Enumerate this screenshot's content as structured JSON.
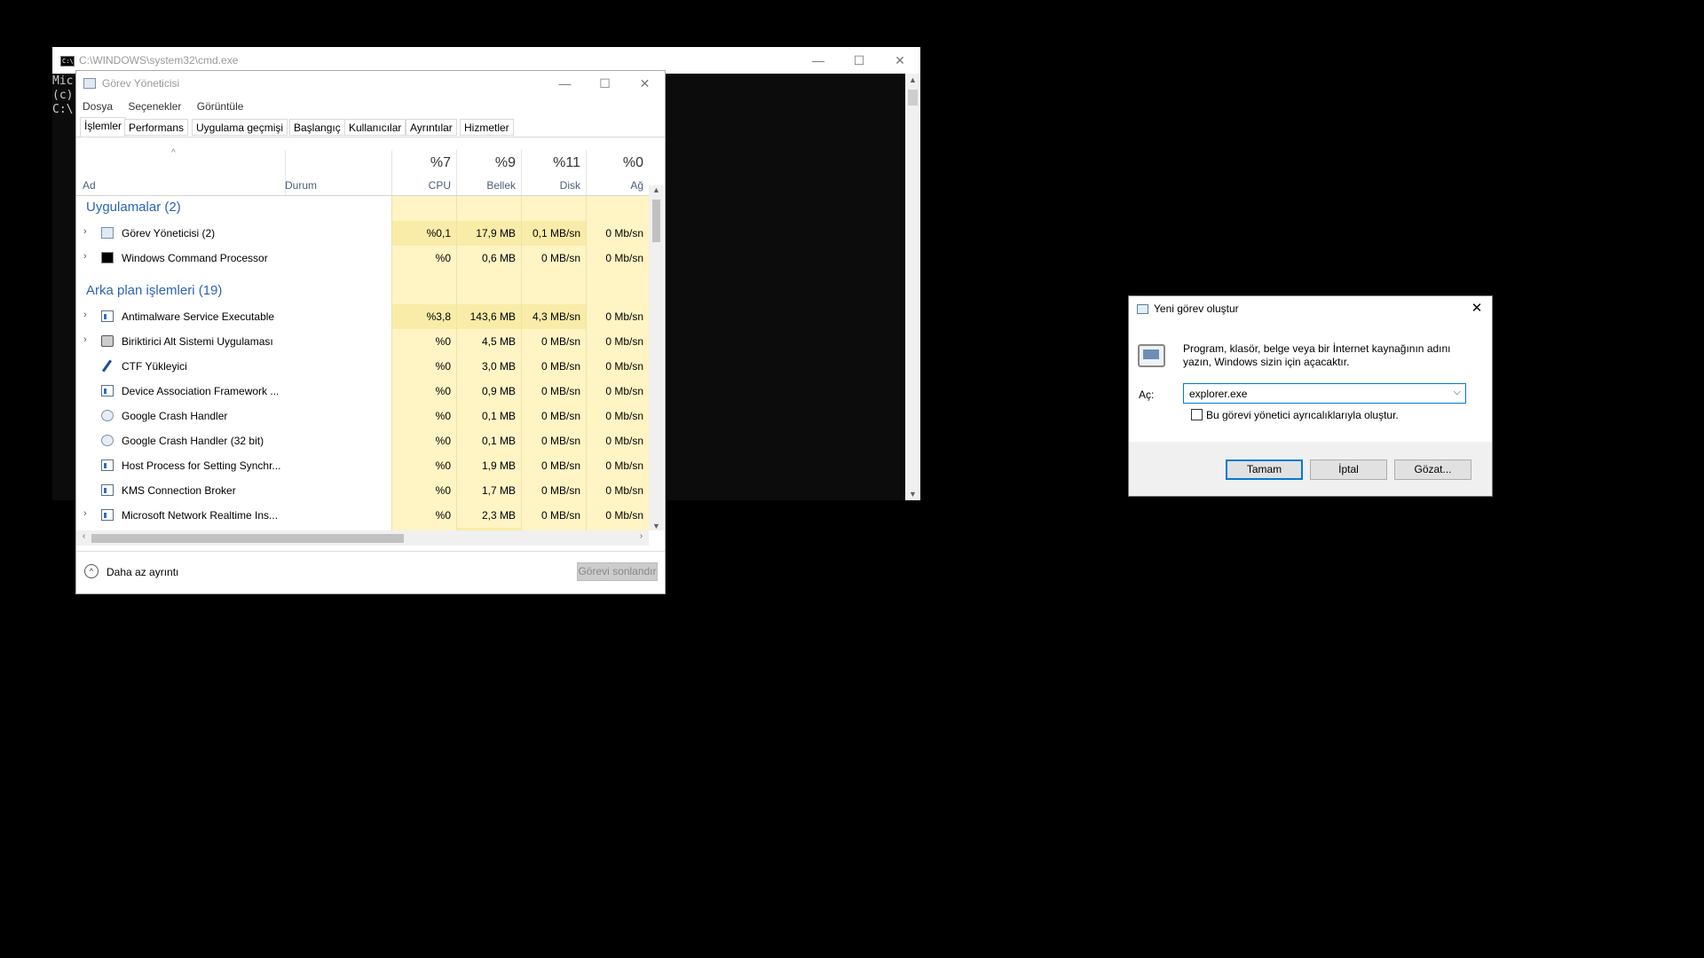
{
  "cmd": {
    "title": "C:\\WINDOWS\\system32\\cmd.exe",
    "lines": [
      "Mic",
      "(c)",
      "",
      "C:\\"
    ],
    "controls": {
      "minimize": "—",
      "maximize": "☐",
      "close": "✕"
    }
  },
  "taskmgr": {
    "title": "Görev Yöneticisi",
    "controls": {
      "minimize": "—",
      "maximize": "☐",
      "close": "✕"
    },
    "menu": [
      "Dosya",
      "Seçenekler",
      "Görüntüle"
    ],
    "tabs": [
      "İşlemler",
      "Performans",
      "Uygulama geçmişi",
      "Başlangıç",
      "Kullanıcılar",
      "Ayrıntılar",
      "Hizmetler"
    ],
    "columns": {
      "name": "Ad",
      "status": "Durum",
      "cpu": {
        "pct": "%7",
        "label": "CPU"
      },
      "mem": {
        "pct": "%9",
        "label": "Bellek"
      },
      "disk": {
        "pct": "%11",
        "label": "Disk"
      },
      "net": {
        "pct": "%0",
        "label": "Ağ"
      }
    },
    "groups": {
      "apps": "Uygulamalar (2)",
      "background": "Arka plan işlemleri (19)"
    },
    "apps": [
      {
        "name": "Görev Yöneticisi (2)",
        "cpu": "%0,1",
        "mem": "17,9 MB",
        "disk": "0,1 MB/sn",
        "net": "0 Mb/sn"
      },
      {
        "name": "Windows Command Processor",
        "cpu": "%0",
        "mem": "0,6 MB",
        "disk": "0 MB/sn",
        "net": "0 Mb/sn"
      }
    ],
    "background": [
      {
        "name": "Antimalware Service Executable",
        "cpu": "%3,8",
        "mem": "143,6 MB",
        "disk": "4,3 MB/sn",
        "net": "0 Mb/sn"
      },
      {
        "name": "Biriktirici Alt Sistemi Uygulaması",
        "cpu": "%0",
        "mem": "4,5 MB",
        "disk": "0 MB/sn",
        "net": "0 Mb/sn"
      },
      {
        "name": "CTF Yükleyici",
        "cpu": "%0",
        "mem": "3,0 MB",
        "disk": "0 MB/sn",
        "net": "0 Mb/sn"
      },
      {
        "name": "Device Association Framework ...",
        "cpu": "%0",
        "mem": "0,9 MB",
        "disk": "0 MB/sn",
        "net": "0 Mb/sn"
      },
      {
        "name": "Google Crash Handler",
        "cpu": "%0",
        "mem": "0,1 MB",
        "disk": "0 MB/sn",
        "net": "0 Mb/sn"
      },
      {
        "name": "Google Crash Handler (32 bit)",
        "cpu": "%0",
        "mem": "0,1 MB",
        "disk": "0 MB/sn",
        "net": "0 Mb/sn"
      },
      {
        "name": "Host Process for Setting Synchr...",
        "cpu": "%0",
        "mem": "1,9 MB",
        "disk": "0 MB/sn",
        "net": "0 Mb/sn"
      },
      {
        "name": "KMS Connection Broker",
        "cpu": "%0",
        "mem": "1,7 MB",
        "disk": "0 MB/sn",
        "net": "0 Mb/sn"
      },
      {
        "name": "Microsoft Network Realtime Ins...",
        "cpu": "%0",
        "mem": "2,3 MB",
        "disk": "0 MB/sn",
        "net": "0 Mb/sn"
      }
    ],
    "footer": {
      "fewer_details": "Daha az ayrıntı",
      "end_task": "Görevi sonlandır"
    }
  },
  "run": {
    "title": "Yeni görev oluştur",
    "close": "✕",
    "description": "Program, klasör, belge veya bir İnternet kaynağının adını yazın, Windows sizin için açacaktır.",
    "open_label": "Aç:",
    "open_value": "explorer.exe",
    "admin_label": "Bu görevi yönetici ayrıcalıklarıyla oluştur.",
    "admin_checked": false,
    "buttons": {
      "ok": "Tamam",
      "cancel": "İptal",
      "browse": "Gözat..."
    }
  }
}
